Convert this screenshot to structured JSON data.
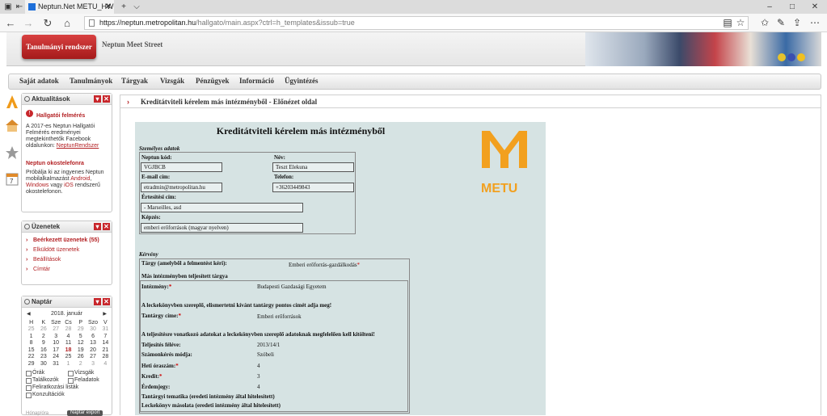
{
  "browser": {
    "tab_title": "Neptun.Net METU_HW",
    "tab_close": "✕",
    "new_tab": "+",
    "tab_list": "⌵",
    "url_host": "https://neptun.metropolitan.hu",
    "url_path": "/hallgato/main.aspx?ctrl=h_templates&issub=true",
    "win_min": "–",
    "win_max": "□",
    "win_close": "✕"
  },
  "header": {
    "button_label": "Tanulmányi rendszer",
    "school_name": "Neptun Meet Street"
  },
  "menu": [
    "Saját adatok",
    "Tanulmányok",
    "Tárgyak",
    "Vizsgák",
    "Pénzügyek",
    "Információ",
    "Ügyintézés"
  ],
  "news": {
    "title": "Aktualitások",
    "item1_title": "Hallgatói felmérés",
    "item1_text": "A 2017-es Neptun Hallgatói Felmérés eredményei megtekinthetők Facebook oldalunkon:",
    "item1_link": "NeptunRendszer",
    "item2_title": "Neptun okostelefonra",
    "item2_text_a": "Próbálja ki az ingyenes Neptun mobilalkalmazást",
    "item2_android": "Android",
    "item2_text_b": ",",
    "item2_windows": "Windows",
    "item2_text_c": "vagy",
    "item2_ios": "iOS",
    "item2_text_d": "rendszerű okostelefonon."
  },
  "messages": {
    "title": "Üzenetek",
    "items": [
      "Beérkezett üzenetek (55)",
      "Elküldött üzenetek",
      "Beállítások",
      "Címtár"
    ]
  },
  "calendar": {
    "title": "Naptár",
    "month": "2018. január",
    "weekdays": [
      "H",
      "K",
      "Sze",
      "Cs",
      "P",
      "Szo",
      "V"
    ],
    "weeks": [
      [
        "25",
        "26",
        "27",
        "28",
        "29",
        "30",
        "31"
      ],
      [
        "1",
        "2",
        "3",
        "4",
        "5",
        "6",
        "7"
      ],
      [
        "8",
        "9",
        "10",
        "11",
        "12",
        "13",
        "14"
      ],
      [
        "15",
        "16",
        "17",
        "18",
        "19",
        "20",
        "21"
      ],
      [
        "22",
        "23",
        "24",
        "25",
        "26",
        "27",
        "28"
      ],
      [
        "29",
        "30",
        "31",
        "1",
        "2",
        "3",
        "4"
      ]
    ],
    "filters": [
      "Órák",
      "Vizsgák",
      "Találkozók",
      "Feladatok",
      "Feliratkozási listák",
      "Konzultációk"
    ],
    "footer_left": "Hónap/óra",
    "footer_button": "Naptár export"
  },
  "breadcrumb": "Kreditátviteli kérelem más intézményből - Előnézet oldal",
  "form": {
    "title": "Kreditátviteli kérelem más intézményből",
    "personal_section": "Személyes adatok",
    "neptun_label": "Neptun kód:",
    "neptun_value": "VGJBCB",
    "name_label": "Név:",
    "name_value": "Teszt Elekuna",
    "email_label": "E-mail cím:",
    "email_value": "etradmin@metropolitan.hu",
    "phone_label": "Telefon:",
    "phone_value": "+36203449843",
    "address_label": "Értesítési cím:",
    "address_value": "- Marseilles, asd",
    "training_label": "Képzés:",
    "training_value": "emberi erőforrások (magyar nyelven)",
    "request_section": "Kérvény",
    "subject_label": "Tárgy (amelyből a felmentést kéri):",
    "subject_value": "Emberi erőforrás-gazdálkodás",
    "other_inst_label": "Más intézményben teljesített tárgya",
    "institution_label": "Intézmény:",
    "institution_value": "Budapesti Gazdasági Egyetem",
    "note1": "A leckekönyvben szereplő, elismertetni kívánt tantárgy pontos címét adja meg!",
    "course_title_label": "Tantárgy címe:",
    "course_title_value": "Emberi erőforrások",
    "note2": "A teljesítésre vonatkozó adatokat a leckekönyvben szereplő adatoknak megfelelően kell kitölteni!",
    "semester_label": "Teljesítés féléve:",
    "semester_value": "2013/14/1",
    "exam_label": "Számonkérés módja:",
    "exam_value": "Szóbeli",
    "hours_label": "Heti óraszám:",
    "hours_value": "4",
    "credit_label": "Kredit:",
    "credit_value": "3",
    "grade_label": "Érdemjegy:",
    "grade_value": "4",
    "syllabus_label": "Tantárgyi tematika (eredeti intézmény által hitelesített)",
    "transcript_label": "Leckekönyv másolata (eredeti intézmény által hitelesített)"
  },
  "logo_text": "METU"
}
